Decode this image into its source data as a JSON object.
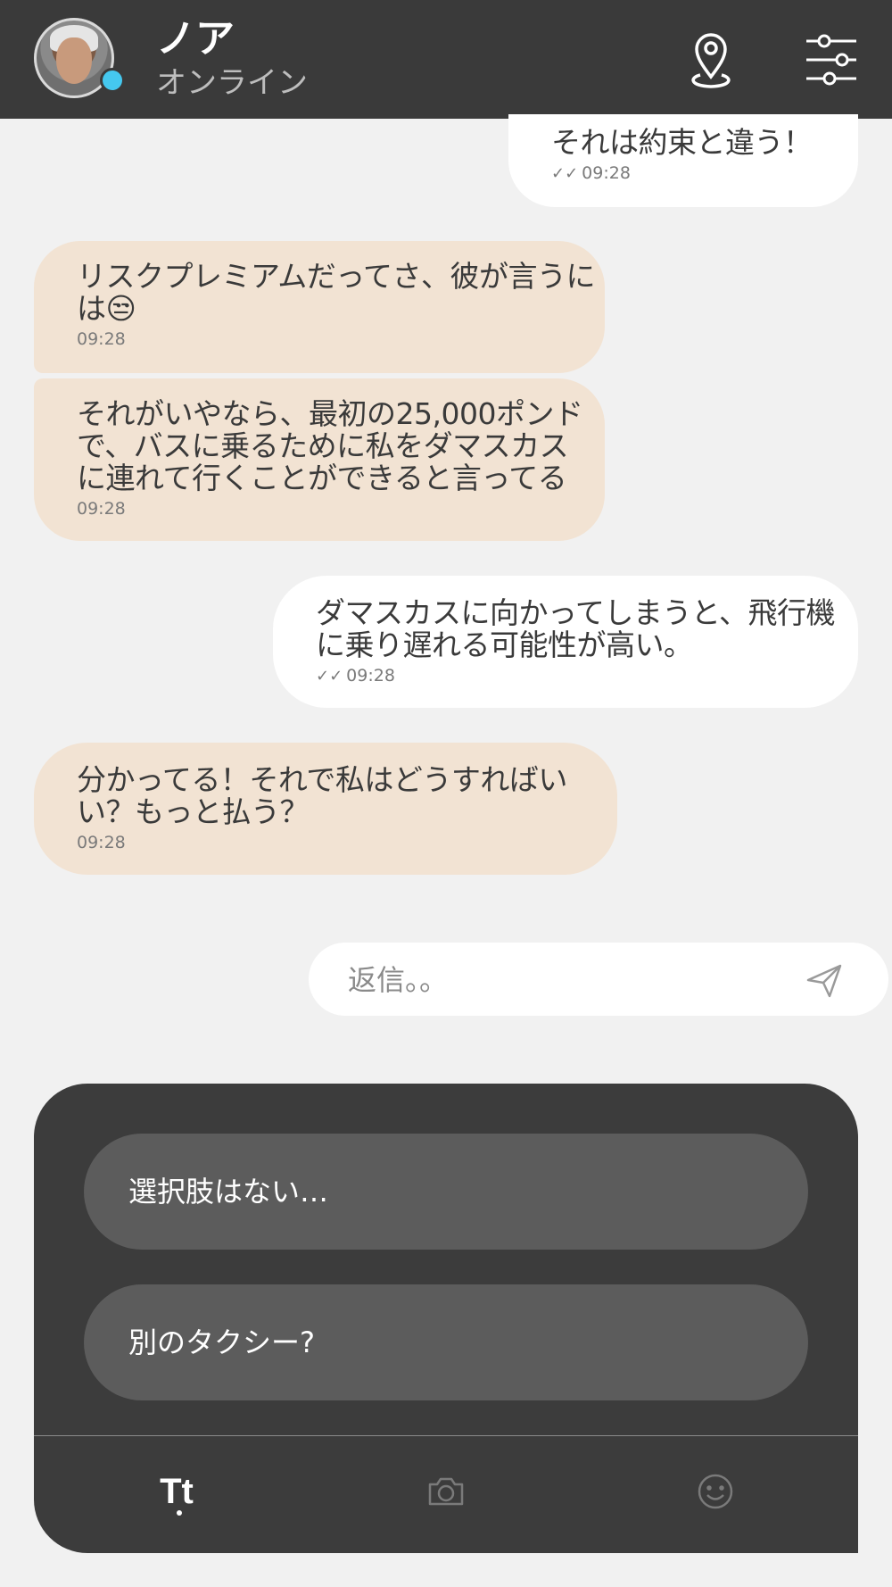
{
  "header": {
    "name": "ノア",
    "status": "オンライン",
    "icons": [
      "avatar",
      "location-pin-icon",
      "sliders-icon"
    ]
  },
  "messages": [
    {
      "side": "out",
      "lines": [
        "それは約束と違う！"
      ],
      "time": "09:28",
      "ticks": "✓✓"
    },
    {
      "side": "in",
      "lines": [
        "リスクプレミアムだってさ、彼が言うに",
        "は😒"
      ],
      "time": "09:28"
    },
    {
      "side": "in",
      "lines": [
        "それがいやなら、最初の25,000ポンド",
        "で、バスに乗るために私をダマスカス",
        "に連れて行くことができると言ってる"
      ],
      "time": "09:28"
    },
    {
      "side": "out",
      "lines": [
        "ダマスカスに向かってしまうと、飛行機",
        "に乗り遅れる可能性が高い。"
      ],
      "time": "09:28",
      "ticks": "✓✓"
    },
    {
      "side": "in",
      "lines": [
        "分かってる！それで私はどうすればい",
        "い？もっと払う？"
      ],
      "time": "09:28"
    }
  ],
  "reply": {
    "placeholder": "返信。。",
    "send_icon": "send-icon"
  },
  "choices": [
    "選択肢はない…",
    "別のタクシー?"
  ],
  "tabs": {
    "text_label": "Tt",
    "camera_icon": "camera-icon",
    "emoji_icon": "smiley-icon"
  },
  "colors": {
    "header_bg": "#3a3a3a",
    "incoming_bubble": "#f2e3d3",
    "outgoing_bubble": "#ffffff",
    "online": "#45c8ef",
    "panel_bg": "#3c3c3c",
    "choice_bg": "#5c5c5c"
  }
}
